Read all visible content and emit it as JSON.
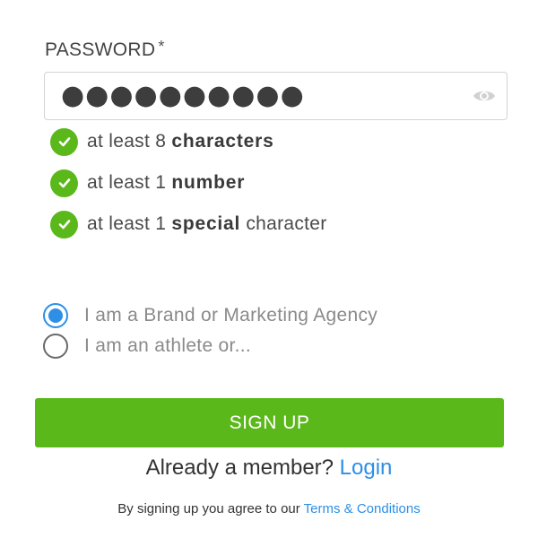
{
  "password_field": {
    "label": "PASSWORD",
    "required_marker": "*",
    "value": "●●●●●●●●●●",
    "toggle_icon": "eye-icon"
  },
  "password_rules": [
    {
      "prefix": "at least 8 ",
      "bold": "characters",
      "suffix": "",
      "status": "met"
    },
    {
      "prefix": "at least 1 ",
      "bold": "number",
      "suffix": "",
      "status": "met"
    },
    {
      "prefix": "at least 1 ",
      "bold": "special",
      "suffix": " character",
      "status": "met"
    }
  ],
  "account_type": {
    "options": [
      {
        "label": "I am a Brand or Marketing Agency",
        "selected": true
      },
      {
        "label": "I am an athlete or...",
        "selected": false
      }
    ]
  },
  "signup": {
    "button_label": "SIGN UP"
  },
  "member": {
    "prompt": "Already a member?",
    "login_label": "Login"
  },
  "terms": {
    "prefix": "By signing up you agree to our",
    "link_label": "Terms & Conditions"
  },
  "colors": {
    "accent_green": "#5bb81a",
    "link_blue": "#2d8fe6"
  }
}
